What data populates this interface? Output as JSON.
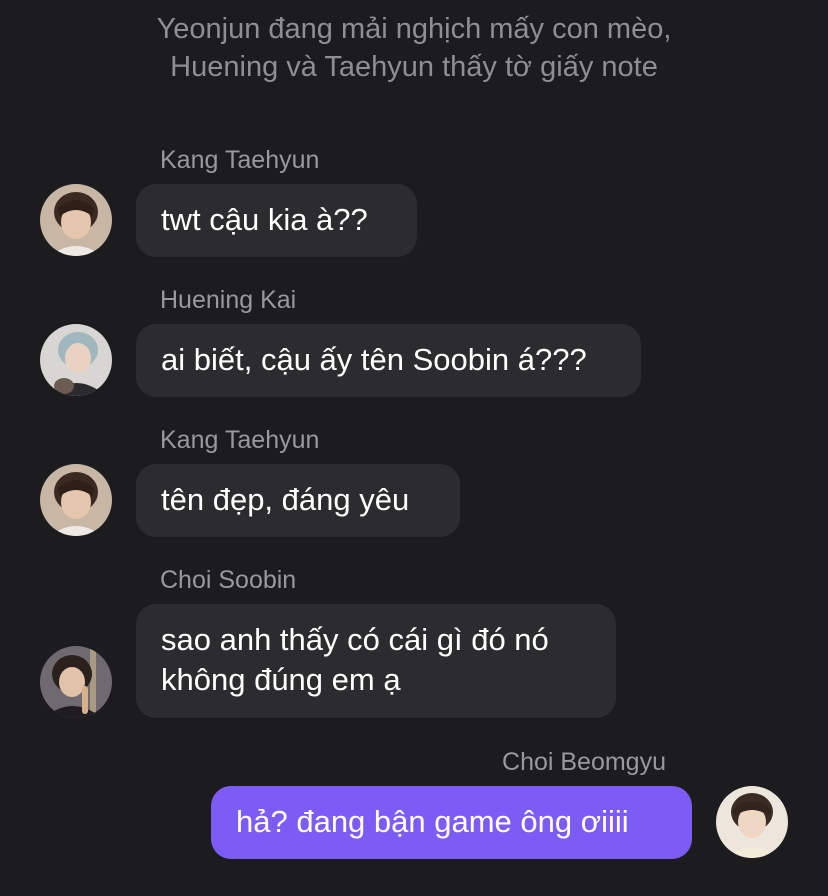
{
  "system_note": {
    "line1": "Yeonjun đang mải nghịch mấy con mèo,",
    "line2": "Huening và Taehyun thấy tờ giấy note"
  },
  "messages": [
    {
      "sender": "Kang Taehyun",
      "text": [
        "twt cậu kia à??"
      ],
      "avatar": "taehyun-avatar-photo",
      "outgoing": false
    },
    {
      "sender": "Huening Kai",
      "text": [
        "ai biết, cậu ấy tên Soobin á???"
      ],
      "avatar": "hueningkai-avatar-photo",
      "outgoing": false
    },
    {
      "sender": "Kang Taehyun",
      "text": [
        "tên đẹp, đáng yêu"
      ],
      "avatar": "taehyun-avatar-photo",
      "outgoing": false
    },
    {
      "sender": "Choi Soobin",
      "text": [
        "sao anh thấy có cái gì đó nó",
        "không đúng em ạ"
      ],
      "avatar": "soobin-avatar-photo",
      "outgoing": false
    },
    {
      "sender": "Choi Beomgyu",
      "text": [
        "hả? đang bận game ông ơiiii"
      ],
      "avatar": "beomgyu-avatar-photo",
      "outgoing": true
    }
  ],
  "colors": {
    "background": "#1c1c1e",
    "incoming_bubble": "#2c2c2e",
    "outgoing_bubble": "#7d5cf6",
    "sender_name": "#98989e",
    "system_text": "#8e8e93"
  }
}
